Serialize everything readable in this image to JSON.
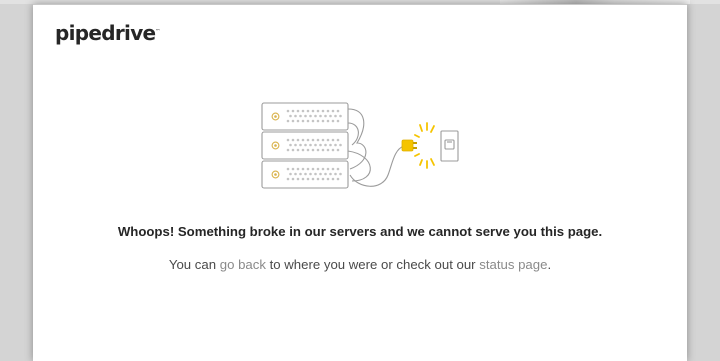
{
  "brand": {
    "logo_text": "pipedrive"
  },
  "error": {
    "headline": "Whoops! Something broke in our servers and we cannot serve you this page.",
    "text_before": "You can ",
    "link_back": "go back",
    "text_middle": " to where you were or check out our ",
    "link_status": "status page",
    "text_end": "."
  },
  "colors": {
    "accent_yellow": "#f5c400",
    "illustration_stroke": "#9b9b9b",
    "text_dark": "#262626",
    "link_gray": "#8a8a8a"
  }
}
